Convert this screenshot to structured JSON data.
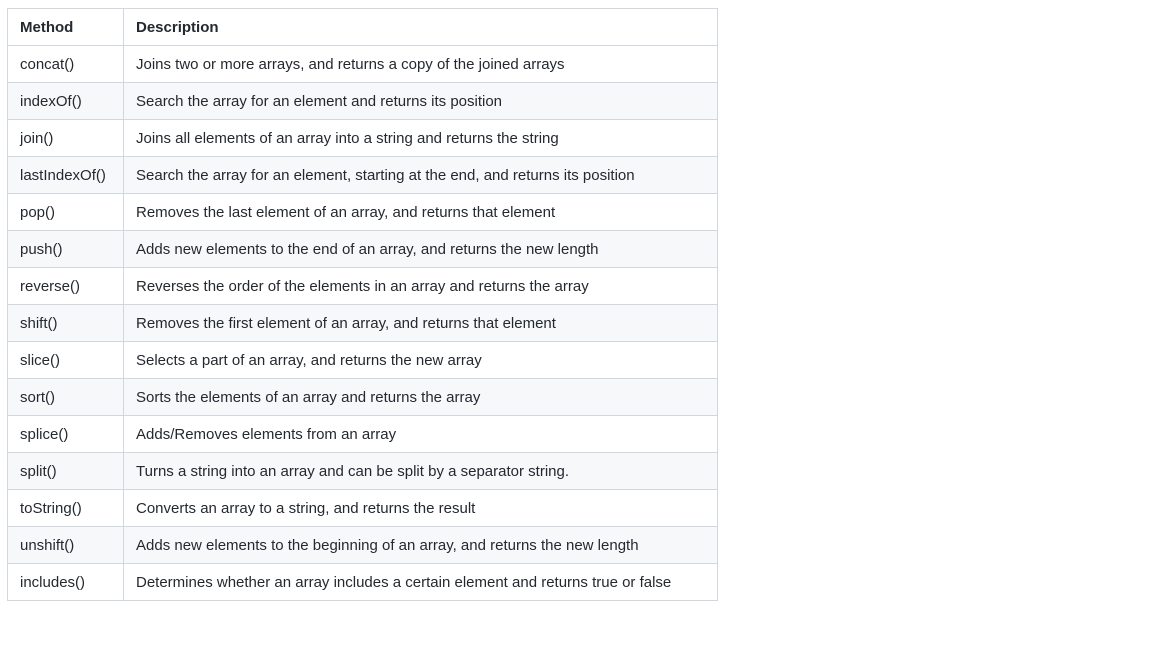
{
  "table": {
    "headers": {
      "method": "Method",
      "description": "Description"
    },
    "rows": [
      {
        "method": "concat()",
        "description": "Joins two or more arrays, and returns a copy of the joined arrays"
      },
      {
        "method": "indexOf()",
        "description": "Search the array for an element and returns its position"
      },
      {
        "method": "join()",
        "description": "Joins all elements of an array into a string and returns the string"
      },
      {
        "method": "lastIndexOf()",
        "description": "Search the array for an element, starting at the end, and returns its position"
      },
      {
        "method": "pop()",
        "description": "Removes the last element of an array, and returns that element"
      },
      {
        "method": "push()",
        "description": "Adds new elements to the end of an array, and returns the new length"
      },
      {
        "method": "reverse()",
        "description": "Reverses the order of the elements in an array and returns the array"
      },
      {
        "method": "shift()",
        "description": "Removes the first element of an array, and returns that element"
      },
      {
        "method": "slice()",
        "description": "Selects a part of an array, and returns the new array"
      },
      {
        "method": "sort()",
        "description": "Sorts the elements of an array and returns the array"
      },
      {
        "method": "splice()",
        "description": "Adds/Removes elements from an array"
      },
      {
        "method": "split()",
        "description": "Turns a string into an array and can be split by a separator string."
      },
      {
        "method": "toString()",
        "description": "Converts an array to a string, and returns the result"
      },
      {
        "method": "unshift()",
        "description": "Adds new elements to the beginning of an array, and returns the new length"
      },
      {
        "method": "includes()",
        "description": "Determines whether an array includes a certain element and returns true or false"
      }
    ]
  }
}
